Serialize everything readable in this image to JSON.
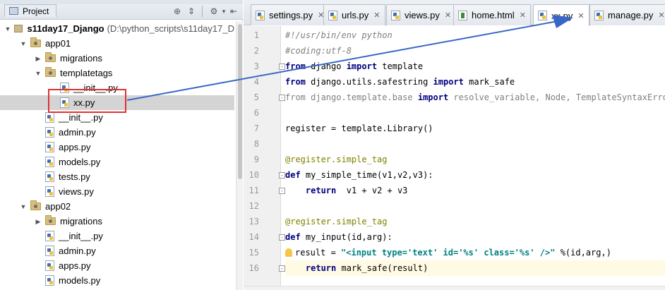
{
  "window": {
    "title_fragment": "s11day17_Django"
  },
  "project_pane": {
    "tab_label": "Project",
    "tree": [
      {
        "label": "s11day17_Django",
        "path": "(D:\\python_scripts\\s11day17_D",
        "kind": "root",
        "expanded": true,
        "depth": 0
      },
      {
        "label": "app01",
        "kind": "package",
        "expanded": true,
        "depth": 1
      },
      {
        "label": "migrations",
        "kind": "package",
        "expanded": false,
        "depth": 2
      },
      {
        "label": "templatetags",
        "kind": "package",
        "expanded": true,
        "depth": 2
      },
      {
        "label": "__init__.py",
        "kind": "file",
        "depth": 3
      },
      {
        "label": "xx.py",
        "kind": "file",
        "depth": 3,
        "selected": true
      },
      {
        "label": "__init__.py",
        "kind": "file",
        "depth": 2
      },
      {
        "label": "admin.py",
        "kind": "file",
        "depth": 2
      },
      {
        "label": "apps.py",
        "kind": "file",
        "depth": 2
      },
      {
        "label": "models.py",
        "kind": "file",
        "depth": 2
      },
      {
        "label": "tests.py",
        "kind": "file",
        "depth": 2
      },
      {
        "label": "views.py",
        "kind": "file",
        "depth": 2
      },
      {
        "label": "app02",
        "kind": "package",
        "expanded": true,
        "depth": 1
      },
      {
        "label": "migrations",
        "kind": "package",
        "expanded": false,
        "depth": 2
      },
      {
        "label": "__init__.py",
        "kind": "file",
        "depth": 2
      },
      {
        "label": "admin.py",
        "kind": "file",
        "depth": 2
      },
      {
        "label": "apps.py",
        "kind": "file",
        "depth": 2
      },
      {
        "label": "models.py",
        "kind": "file",
        "depth": 2
      }
    ]
  },
  "editor": {
    "tabs": [
      {
        "label": "settings.py",
        "icon": "python-file-icon",
        "active": false
      },
      {
        "label": "urls.py",
        "icon": "python-file-icon",
        "active": false
      },
      {
        "label": "views.py",
        "icon": "python-file-icon",
        "active": false
      },
      {
        "label": "home.html",
        "icon": "html-file-icon",
        "active": false
      },
      {
        "label": "xx.py",
        "icon": "python-file-icon",
        "active": true
      },
      {
        "label": "manage.py",
        "icon": "python-file-icon",
        "active": false
      }
    ],
    "current_line": 16,
    "lines": [
      {
        "n": "1",
        "segs": [
          [
            "cm",
            "#!/usr/bin/env python"
          ]
        ]
      },
      {
        "n": "2",
        "segs": [
          [
            "cm",
            "#coding:utf-8"
          ]
        ]
      },
      {
        "n": "3",
        "segs": [
          [
            "kw",
            "from"
          ],
          [
            "",
            " django "
          ],
          [
            "kw",
            "import"
          ],
          [
            "",
            " template"
          ]
        ]
      },
      {
        "n": "4",
        "segs": [
          [
            "kw",
            "from"
          ],
          [
            "",
            " django.utils.safestring "
          ],
          [
            "kw",
            "import"
          ],
          [
            "",
            " mark_safe"
          ]
        ]
      },
      {
        "n": "5",
        "segs": [
          [
            "dim",
            "from django.template.base "
          ],
          [
            "kw",
            "import"
          ],
          [
            "dim",
            " resolve_variable, Node, TemplateSyntaxError"
          ]
        ]
      },
      {
        "n": "6",
        "segs": []
      },
      {
        "n": "7",
        "segs": [
          [
            "",
            "register = template.Library()"
          ]
        ]
      },
      {
        "n": "8",
        "segs": []
      },
      {
        "n": "9",
        "segs": [
          [
            "deco",
            "@register.simple_tag"
          ]
        ]
      },
      {
        "n": "10",
        "segs": [
          [
            "kw",
            "def"
          ],
          [
            "",
            " my_simple_time(v1,v2,v3):"
          ]
        ]
      },
      {
        "n": "11",
        "segs": [
          [
            "",
            "    "
          ],
          [
            "kw",
            "return"
          ],
          [
            "",
            "  v1 + v2 + v3"
          ]
        ]
      },
      {
        "n": "12",
        "segs": []
      },
      {
        "n": "13",
        "segs": [
          [
            "deco",
            "@register.simple_tag"
          ]
        ]
      },
      {
        "n": "14",
        "segs": [
          [
            "kw",
            "def"
          ],
          [
            "",
            " my_input(id,arg):"
          ]
        ]
      },
      {
        "n": "15",
        "segs": [
          [
            "",
            "result = "
          ],
          [
            "str",
            "\"<input type='text' id='%s' class='%s' />\""
          ],
          [
            "",
            " %(id,arg,)"
          ]
        ]
      },
      {
        "n": "16",
        "segs": [
          [
            "",
            "    "
          ],
          [
            "kw",
            "return"
          ],
          [
            "",
            " mark_safe(result)"
          ]
        ]
      }
    ]
  }
}
